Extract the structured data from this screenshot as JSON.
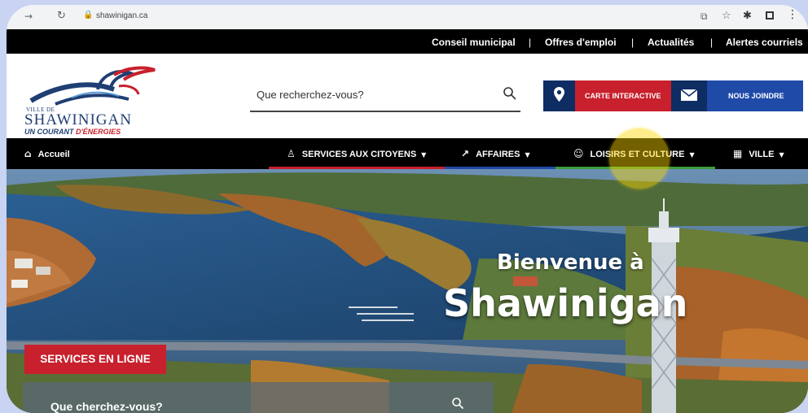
{
  "browser": {
    "url": "shawinigan.ca",
    "icons": [
      "back-arrow-icon",
      "reload-icon",
      "lock-icon",
      "share-icon",
      "star-icon",
      "extensions-icon",
      "sidepanel-icon",
      "menu-icon"
    ]
  },
  "top_links": [
    "Conseil municipal",
    "|",
    "Offres d'emploi",
    "|",
    "Actualités",
    "|",
    "Alertes courriels"
  ],
  "logo": {
    "ville": "VILLE DE",
    "name": "SHAWINIGAN",
    "tagline_a": "UN COURANT",
    "tagline_b": "D'ÉNERGIES"
  },
  "search": {
    "placeholder": "Que recherchez-vous?"
  },
  "buttons": {
    "carte": "CARTE INTERACTIVE",
    "nous": "NOUS JOINDRE"
  },
  "nav": {
    "home": "Accueil",
    "services": "SERVICES AUX CITOYENS",
    "affaires": "AFFAIRES",
    "loisirs": "LOISIRS ET CULTURE",
    "ville": "VILLE"
  },
  "hero": {
    "welcome_line1": "Bienvenue à",
    "welcome_line2": "Shawinigan",
    "services_button": "SERVICES EN LIGNE",
    "search_placeholder": "Que cherchez-vous?"
  },
  "colors": {
    "brand_red": "#c8202c",
    "brand_navy": "#0d2d63",
    "brand_blue": "#1f4aa8",
    "nav_services_bar": "#c8202c",
    "nav_affaires_bar": "#1f4aa8",
    "nav_loisirs_bar": "#3d9a3a",
    "highlight": "#ffd600"
  }
}
